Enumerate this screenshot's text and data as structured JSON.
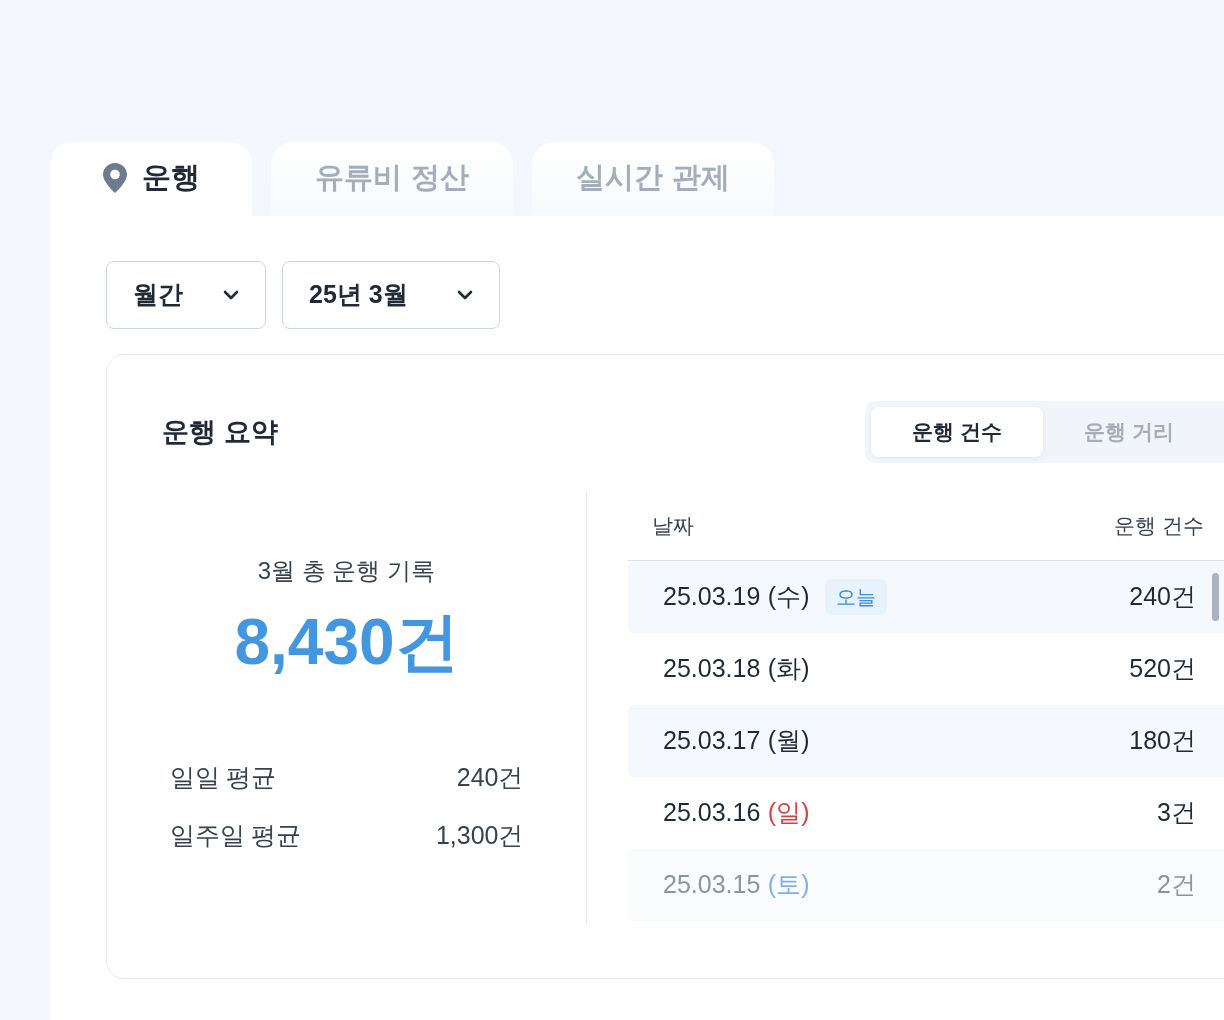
{
  "tabs": [
    {
      "label": "운행",
      "selected": true
    },
    {
      "label": "유류비 정산",
      "selected": false
    },
    {
      "label": "실시간 관제",
      "selected": false
    }
  ],
  "filters": [
    {
      "value": "월간"
    },
    {
      "value": "25년 3월"
    }
  ],
  "summary": {
    "title": "운행 요약",
    "segments": [
      {
        "label": "운행 건수",
        "selected": true
      },
      {
        "label": "운행 거리",
        "selected": false
      }
    ],
    "total_label": "3월 총 운행 기록",
    "total_value": "8,430건",
    "averages": [
      {
        "label": "일일 평균",
        "value": "240건"
      },
      {
        "label": "일주일 평균",
        "value": "1,300건"
      }
    ],
    "table": {
      "columns": [
        "날짜",
        "운행 건수"
      ],
      "rows": [
        {
          "date": "25.03.19",
          "weekday": "(수)",
          "color": "#1f2937",
          "badge": "오늘",
          "count": "240건"
        },
        {
          "date": "25.03.18",
          "weekday": "(화)",
          "color": "#1f2937",
          "count": "520건"
        },
        {
          "date": "25.03.17",
          "weekday": "(월)",
          "color": "#1f2937",
          "count": "180건"
        },
        {
          "date": "25.03.16",
          "weekday": "(일)",
          "color": "#d94141",
          "count": "3건"
        },
        {
          "date": "25.03.15",
          "weekday": "(토)",
          "color": "#7fb3e6",
          "count": "2건"
        }
      ]
    }
  }
}
